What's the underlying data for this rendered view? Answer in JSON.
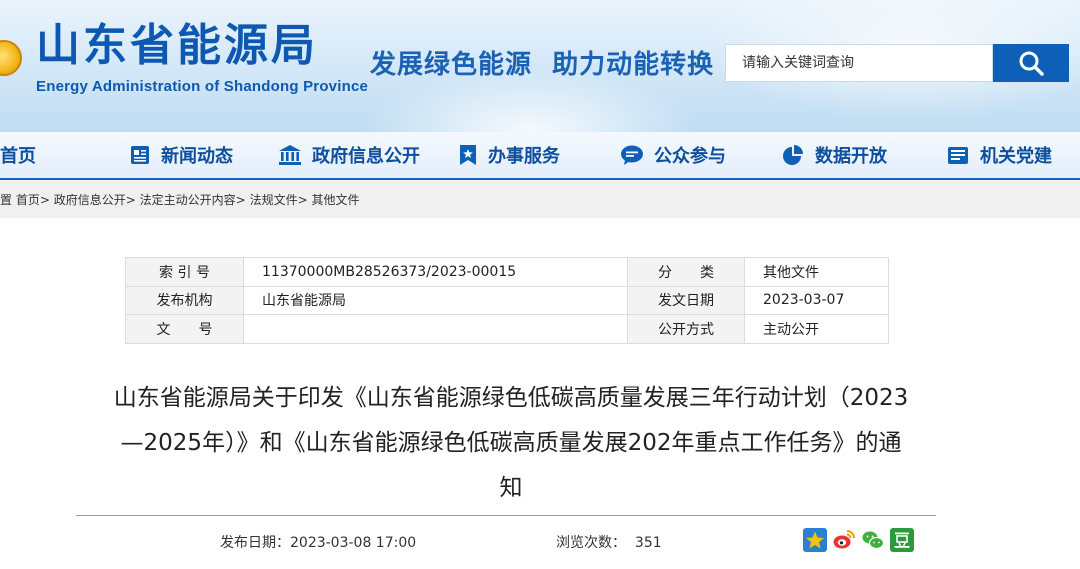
{
  "header": {
    "site_title": "山东省能源局",
    "site_subtitle": "Energy Administration of Shandong Province",
    "slogan": "发展绿色能源  助力动能转换",
    "search_placeholder": "请输入关键词查询",
    "search_icon": "search-icon"
  },
  "nav": {
    "items": [
      {
        "label": "首页",
        "icon": "home-icon"
      },
      {
        "label": "新闻动态",
        "icon": "newspaper-icon"
      },
      {
        "label": "政府信息公开",
        "icon": "government-icon"
      },
      {
        "label": "办事服务",
        "icon": "bookmark-icon"
      },
      {
        "label": "公众参与",
        "icon": "chat-icon"
      },
      {
        "label": "数据开放",
        "icon": "pie-chart-icon"
      },
      {
        "label": "机关党建",
        "icon": "party-icon"
      }
    ]
  },
  "breadcrumb": {
    "prefix": "置",
    "items": [
      "首页",
      "政府信息公开",
      "法定主动公开内容",
      "法规文件",
      "其他文件"
    ],
    "separator": ">"
  },
  "meta": {
    "index_label": "索 引 号",
    "index_value": "11370000MB28526373/2023-00015",
    "category_label": "分　　类",
    "category_value": "其他文件",
    "agency_label": "发布机构",
    "agency_value": "山东省能源局",
    "date_label": "发文日期",
    "date_value": "2023-03-07",
    "docno_label": "文　　号",
    "docno_value": "",
    "mode_label": "公开方式",
    "mode_value": "主动公开"
  },
  "article": {
    "title_line1": "山东省能源局关于印发《山东省能源绿色低碳高质量发展三年行动计划（2023",
    "title_line2": "—2025年）》和《山东省能源绿色低碳高质量发展202年重点工作任务》的通",
    "title_line3": "知",
    "publish_label": "发布日期：",
    "publish_value": "2023-03-08 17:00",
    "views_label": "浏览次数：",
    "views_value": "351"
  },
  "share": [
    {
      "icon": "qzone-icon",
      "color": "#2a7fd4"
    },
    {
      "icon": "weibo-icon",
      "color": "#e8352e"
    },
    {
      "icon": "wechat-icon",
      "color": "#3fae3a"
    },
    {
      "icon": "douban-icon",
      "color": "#2a9a3a"
    }
  ]
}
